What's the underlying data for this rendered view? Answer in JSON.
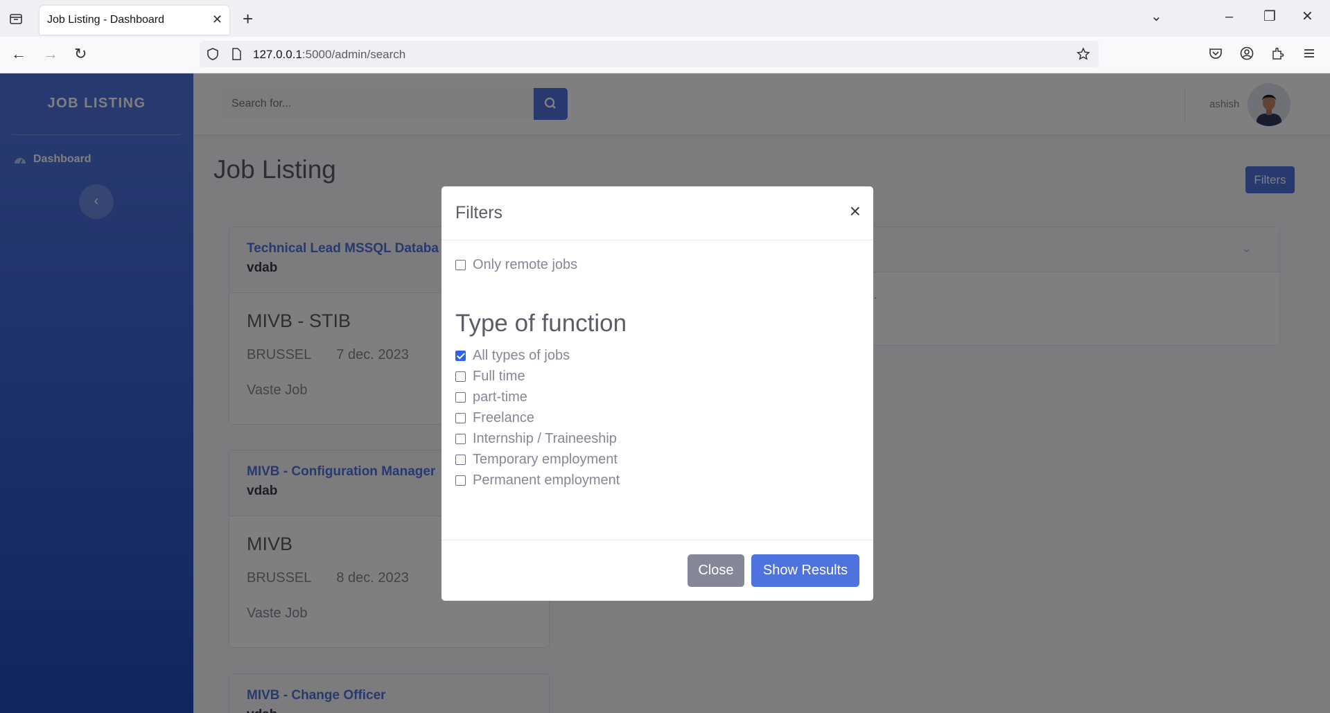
{
  "browser": {
    "tab_title": "Job Listing - Dashboard",
    "url_host": "127.0.0.1",
    "url_rest": ":5000/admin/search"
  },
  "sidebar": {
    "brand": "JOB LISTING",
    "nav_dashboard": "Dashboard"
  },
  "topbar": {
    "search_placeholder": "Search for...",
    "username": "ashish"
  },
  "main": {
    "title": "Job Listing",
    "filters_button": "Filters",
    "jobs": [
      {
        "title": "Technical Lead MSSQL Databa",
        "company": "vdab",
        "employer": "MIVB - STIB",
        "location": "BRUSSEL",
        "date": "7 dec. 2023",
        "type": "Vaste Job"
      },
      {
        "title": "MIVB - Configuration Manager",
        "company": "vdab",
        "employer": "MIVB",
        "location": "BRUSSEL",
        "date": "8 dec. 2023",
        "type": "Vaste Job"
      },
      {
        "title": "MIVB - Change Officer",
        "company": "vdab"
      }
    ],
    "detail_text": "."
  },
  "modal": {
    "title": "Filters",
    "remote_label": "Only remote jobs",
    "remote_checked": false,
    "section_title": "Type of function",
    "options": [
      {
        "label": "All types of jobs",
        "checked": true
      },
      {
        "label": "Full time",
        "checked": false
      },
      {
        "label": "part-time",
        "checked": false
      },
      {
        "label": "Freelance",
        "checked": false
      },
      {
        "label": "Internship / Traineeship",
        "checked": false
      },
      {
        "label": "Temporary employment",
        "checked": false
      },
      {
        "label": "Permanent employment",
        "checked": false
      }
    ],
    "close_button": "Close",
    "show_button": "Show Results"
  },
  "colors": {
    "primary": "#4e73df",
    "secondary": "#858796",
    "checkbox_checked": "#2d62ed"
  }
}
